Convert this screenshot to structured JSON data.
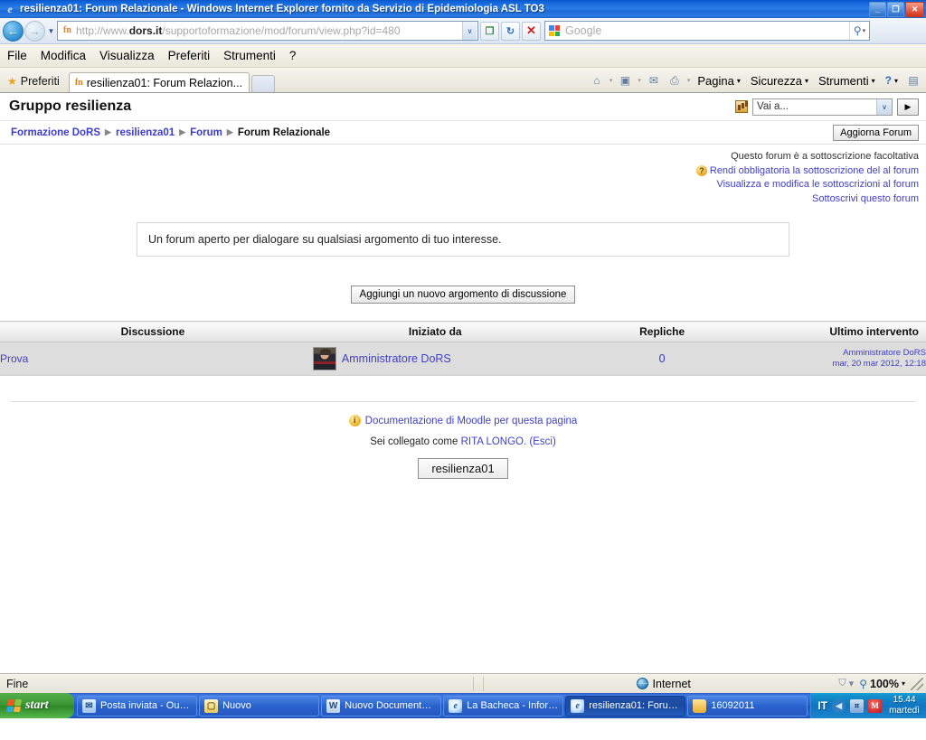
{
  "window": {
    "title": "resilienza01: Forum Relazionale - Windows Internet Explorer fornito da Servizio di Epidemiologia ASL TO3",
    "minimize_label": "_",
    "maximize_label": "❐",
    "close_label": "✕"
  },
  "addressbar": {
    "scheme": "http://www.",
    "domain": "dors.it",
    "path": "/supportoformazione/mod/forum/view.php?id=480",
    "dropdown_caret": "∨",
    "buttons": {
      "compat_label": "❐",
      "refresh_label": "↻",
      "stop_label": "✕"
    },
    "search": {
      "placeholder": "Google",
      "go_label": "⚲",
      "caret": "▾"
    }
  },
  "menubar": {
    "items": [
      "File",
      "Modifica",
      "Visualizza",
      "Preferiti",
      "Strumenti",
      "?"
    ]
  },
  "favbar": {
    "favorites_label": "Preferiti",
    "star_icon": "★",
    "tab_label": "resilienza01: Forum Relazion...",
    "tab_icon": "fn",
    "commands": {
      "home_icon": "⌂",
      "feeds_icon": "▣",
      "mail_icon": "✉",
      "print_icon": "⎙",
      "caret": "▾",
      "page": "Pagina",
      "security": "Sicurezza",
      "tools": "Strumenti",
      "help_icon": "?",
      "extra_icon": "▤"
    }
  },
  "moodle": {
    "page_title": "Gruppo resilienza",
    "jump": {
      "selected": "Vai a...",
      "caret": "∨",
      "go_label": "▶"
    },
    "breadcrumb": {
      "items": [
        "Formazione DoRS",
        "resilienza01",
        "Forum"
      ],
      "current": "Forum Relazionale",
      "separator": "▶"
    },
    "update_button": "Aggiorna Forum",
    "subscription": {
      "status": "Questo forum è a sottoscrizione facoltativa",
      "help_icon": "?",
      "make_mandatory": "Rendi obbligatoria la sottoscrizione del al forum",
      "view_edit": "Visualizza e modifica le sottoscrizioni al forum",
      "subscribe": "Sottoscrivi questo forum"
    },
    "intro": "Un forum aperto per dialogare su qualsiasi argomento di tuo interesse.",
    "add_topic_button": "Aggiungi un nuovo argomento di discussione",
    "table": {
      "headers": [
        "Discussione",
        "Iniziato da",
        "Repliche",
        "Ultimo intervento"
      ],
      "rows": [
        {
          "discussion": "Prova",
          "author": "Amministratore DoRS",
          "replies": "0",
          "last_author": "Amministratore DoRS",
          "last_when": "mar, 20 mar 2012, 12:18"
        }
      ]
    },
    "footer": {
      "info_icon": "i",
      "doc_link": "Documentazione di Moodle per questa pagina",
      "login_prefix": "Sei collegato come",
      "login_user": "RITA LONGO.",
      "logout": "(Esci)",
      "course_button": "resilienza01"
    }
  },
  "statusbar": {
    "status": "Fine",
    "zone": "Internet",
    "lock_icon": "⛉",
    "lock_caret": "▾",
    "zoom_icon": "⚲",
    "zoom_level": "100%",
    "zoom_caret": "▾"
  },
  "taskbar": {
    "start_label": "start",
    "items": [
      {
        "label": "Posta inviata - Outl...",
        "icon": "outlook-icon",
        "active": false
      },
      {
        "label": "Nuovo",
        "icon": "note-icon",
        "active": false
      },
      {
        "label": "Nuovo Documento ...",
        "icon": "word-icon",
        "active": false
      },
      {
        "label": "La Bacheca - Inform...",
        "icon": "ie-icon",
        "active": false
      },
      {
        "label": "resilienza01: Forum ...",
        "icon": "ie-icon",
        "active": true
      },
      {
        "label": "16092011",
        "icon": "folder-icon",
        "active": false
      }
    ],
    "tray": {
      "language": "IT",
      "arrow_icon": "◀",
      "network_icon": "⌗",
      "mcafee_icon": "M",
      "clock_time": "15.44",
      "clock_day": "martedì"
    }
  },
  "colors": {
    "titlebar_blue": "#1e6ad6",
    "link_purple": "#4040c8",
    "taskbar_blue": "#2a62d4",
    "start_green": "#3f9b38",
    "row_gray": "#dddddd"
  }
}
